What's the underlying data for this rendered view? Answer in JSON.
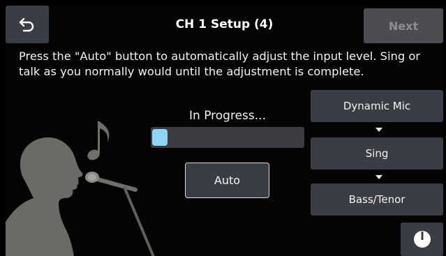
{
  "header": {
    "title": "CH 1 Setup (4)",
    "next_label": "Next"
  },
  "instructions": "Press the \"Auto\" button to automatically adjust the input level. Sing or talk as you normally would until the adjustment is complete.",
  "progress": {
    "label": "In Progress...",
    "value_percent": 10
  },
  "auto_label": "Auto",
  "options": [
    {
      "label": "Dynamic Mic"
    },
    {
      "label": "Sing"
    },
    {
      "label": "Bass/Tenor"
    }
  ],
  "icons": {
    "back": "back-arrow-icon",
    "power": "power-icon",
    "illustration": "singer-silhouette-icon"
  },
  "colors": {
    "background": "#040404",
    "button": "#3a3d44",
    "progress_fill": "#8fd3f5",
    "disabled_text": "#8c8d91"
  }
}
